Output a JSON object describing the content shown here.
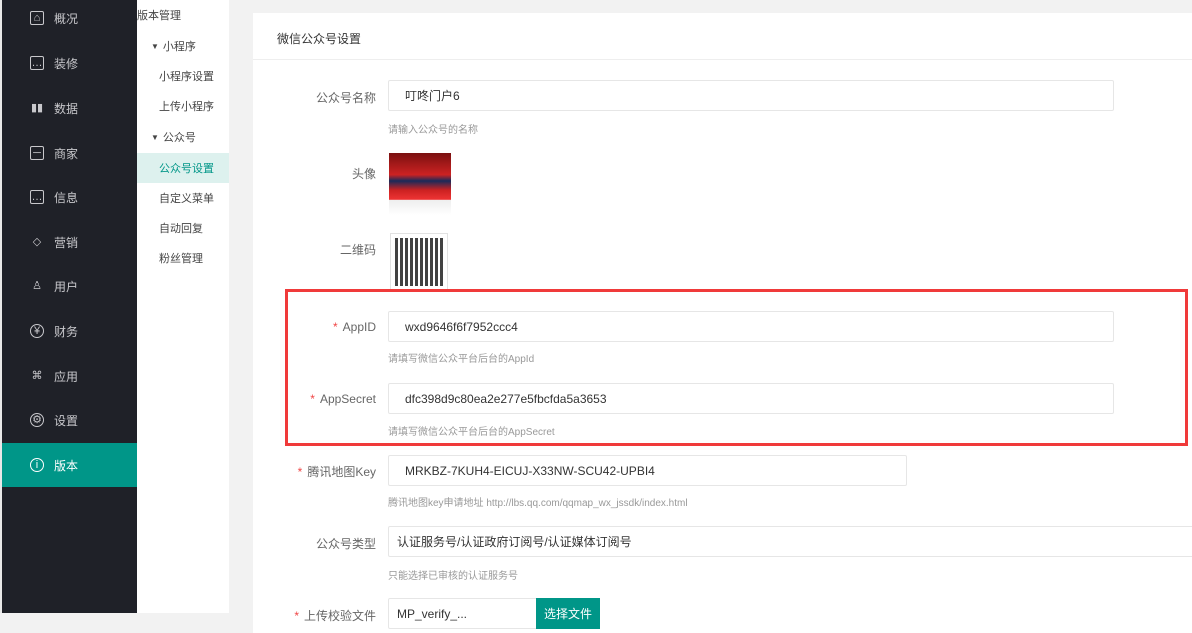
{
  "sidebar": {
    "items": [
      {
        "label": "概况",
        "icon": "dashboard-icon"
      },
      {
        "label": "装修",
        "icon": "message-icon"
      },
      {
        "label": "数据",
        "icon": "bar-chart-icon"
      },
      {
        "label": "商家",
        "icon": "shop-icon"
      },
      {
        "label": "信息",
        "icon": "chat-icon"
      },
      {
        "label": "营销",
        "icon": "tag-icon"
      },
      {
        "label": "用户",
        "icon": "user-icon"
      },
      {
        "label": "财务",
        "icon": "yen-icon"
      },
      {
        "label": "应用",
        "icon": "apps-icon"
      },
      {
        "label": "设置",
        "icon": "gear-icon"
      },
      {
        "label": "版本",
        "icon": "info-icon",
        "active": true
      }
    ]
  },
  "submenu": {
    "version_mgmt": "版本管理",
    "miniprogram": "小程序",
    "mini_settings": "小程序设置",
    "mini_upload": "上传小程序",
    "official": "公众号",
    "official_settings": "公众号设置",
    "custom_menu": "自定义菜单",
    "auto_reply": "自动回复",
    "fans": "粉丝管理"
  },
  "form": {
    "title": "微信公众号设置",
    "name": {
      "label": "公众号名称",
      "value": "叮咚门户6",
      "hint": "请输入公众号的名称"
    },
    "avatar": {
      "label": "头像"
    },
    "qrcode": {
      "label": "二维码"
    },
    "appid": {
      "label": "AppID",
      "value": "wxd9646f6f7952ccc4",
      "hint": "请填写微信公众平台后台的AppId"
    },
    "appsecret": {
      "label": "AppSecret",
      "value": "dfc398d9c80ea2e277e5fbcfda5a3653",
      "hint": "请填写微信公众平台后台的AppSecret"
    },
    "mapkey": {
      "label": "腾讯地图Key",
      "value": "MRKBZ-7KUH4-EICUJ-X33NW-SCU42-UPBI4",
      "hint": "腾讯地图key申请地址 http://lbs.qq.com/qqmap_wx_jssdk/index.html"
    },
    "type": {
      "label": "公众号类型",
      "value": "认证服务号/认证政府订阅号/认证媒体订阅号",
      "hint": "只能选择已审核的认证服务号"
    },
    "upload": {
      "label": "上传校验文件",
      "value": "MP_verify_...",
      "button": "选择文件"
    }
  },
  "colors": {
    "accent": "#009688",
    "highlight": "#f03a3a",
    "sidebar": "#1f2128"
  }
}
